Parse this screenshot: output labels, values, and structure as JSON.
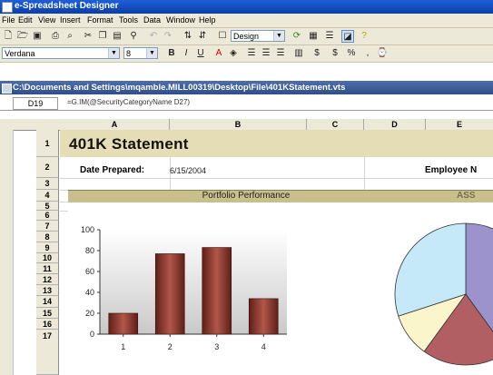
{
  "window": {
    "title": "e-Spreadsheet Designer"
  },
  "menu": [
    "File",
    "Edit",
    "View",
    "Insert",
    "Format",
    "Tools",
    "Data",
    "Window",
    "Help"
  ],
  "toolbar": {
    "style_combo": "Design",
    "font_combo": "Verdana",
    "size_combo": "8"
  },
  "document": {
    "title": "C:\\Documents and Settings\\mqamble.MILL00319\\Desktop\\File\\401KStatement.vts"
  },
  "formula_bar": {
    "cell": "D19",
    "formula": "=G.IM(@SecurityCategoryName D27)"
  },
  "outline_levels": [
    "1",
    "2"
  ],
  "columns": [
    "A",
    "B",
    "C",
    "D",
    "E"
  ],
  "rows": [
    "1",
    "2",
    "3",
    "4",
    "5",
    "6",
    "7",
    "8",
    "9",
    "10",
    "11",
    "12",
    "13",
    "14",
    "15",
    "16",
    "17"
  ],
  "sheet": {
    "statement_title": "401K Statement",
    "date_label": "Date Prepared:",
    "date_value": "6/15/2004",
    "employee_label": "Employee N",
    "portfolio_title": "Portfolio Performance",
    "asset_title": "ASS"
  },
  "colors": {
    "title_band": "#e5ddb6",
    "section_band": "#c8bf8c",
    "bar": "#8b3a2e",
    "titlebar": "#0a3fa8"
  },
  "chart_data": [
    {
      "type": "bar",
      "categories": [
        "1",
        "2",
        "3",
        "4"
      ],
      "values": [
        20,
        77,
        83,
        34
      ],
      "ylim": [
        0,
        100
      ],
      "yticks": [
        0,
        20,
        40,
        60,
        80,
        100
      ],
      "grid": false
    },
    {
      "type": "pie",
      "values": [
        40,
        20,
        10,
        30
      ],
      "colors": [
        "#9c93cc",
        "#b25f63",
        "#fbf5cb",
        "#c5e9f8"
      ],
      "grid": false
    }
  ]
}
